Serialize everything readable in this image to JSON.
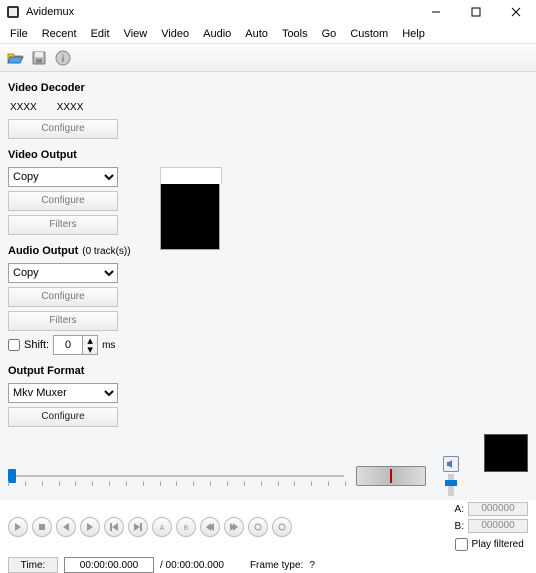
{
  "window": {
    "title": "Avidemux"
  },
  "menu": [
    "File",
    "Recent",
    "Edit",
    "View",
    "Video",
    "Audio",
    "Auto",
    "Tools",
    "Go",
    "Custom",
    "Help"
  ],
  "sections": {
    "video_decoder": {
      "title": "Video Decoder",
      "x1": "XXXX",
      "x2": "XXXX",
      "configure": "Configure"
    },
    "video_output": {
      "title": "Video Output",
      "select": "Copy",
      "configure": "Configure",
      "filters": "Filters"
    },
    "audio_output": {
      "title": "Audio Output",
      "tracks": "(0 track(s))",
      "select": "Copy",
      "configure": "Configure",
      "filters": "Filters",
      "shift_label": "Shift:",
      "shift_value": "0",
      "ms": "ms"
    },
    "output_format": {
      "title": "Output Format",
      "select": "Mkv Muxer",
      "configure": "Configure"
    }
  },
  "bottom": {
    "a_label": "A:",
    "a_value": "000000",
    "b_label": "B:",
    "b_value": "000000",
    "play_filtered": "Play filtered",
    "time_label": "Time:",
    "time_value": "00:00:00.000",
    "time_total": "/ 00:00:00.000",
    "frame_type_label": "Frame type:",
    "frame_type_value": "?"
  }
}
